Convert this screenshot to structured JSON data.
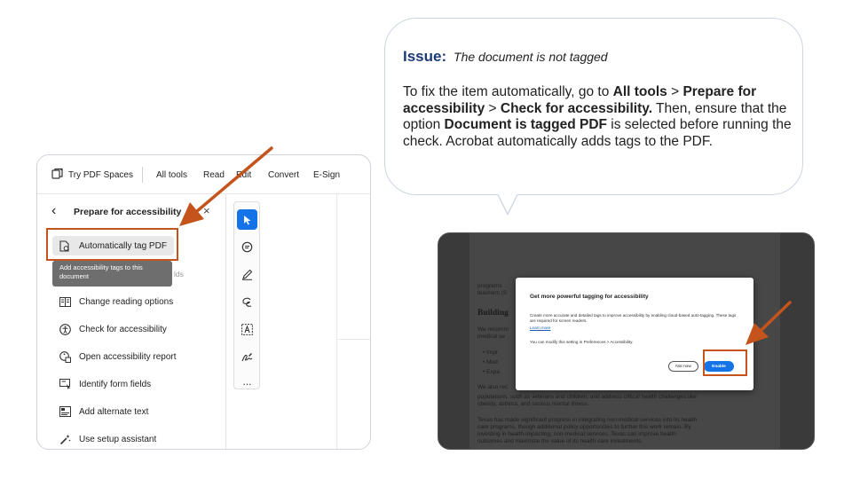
{
  "callout": {
    "issue_label": "Issue:",
    "issue_text": "The document is not tagged",
    "fix_parts": [
      {
        "text": "To fix the item automatically, go to ",
        "bold": false
      },
      {
        "text": "All tools",
        "bold": true
      },
      {
        "text": " > ",
        "bold": false
      },
      {
        "text": "Prepare for accessibility",
        "bold": true
      },
      {
        "text": " > ",
        "bold": false
      },
      {
        "text": "Check for accessibility.",
        "bold": true
      },
      {
        "text": " Then, ensure that the option ",
        "bold": false
      },
      {
        "text": "Document is tagged PDF",
        "bold": true
      },
      {
        "text": " is selected before running the check. Acrobat automatically adds tags to the PDF.",
        "bold": false
      }
    ]
  },
  "acrobat": {
    "topbar": {
      "spaces": "Try PDF Spaces",
      "all_tools": "All tools",
      "read": "Read",
      "edit": "Edit",
      "convert": "Convert",
      "esign": "E-Sign"
    },
    "sidebar_title": "Prepare for accessibility",
    "close_label": "×",
    "tooltip": "Add accessibility tags to this document",
    "tooltip_hidden_tail": "lds",
    "tools": [
      {
        "label": "Automatically tag PDF",
        "icon": "tag-pdf-icon"
      },
      {
        "label": "Change reading options",
        "icon": "reading-options-icon"
      },
      {
        "label": "Check for accessibility",
        "icon": "accessibility-check-icon"
      },
      {
        "label": "Open accessibility report",
        "icon": "accessibility-report-icon"
      },
      {
        "label": "Identify form fields",
        "icon": "form-fields-icon"
      },
      {
        "label": "Add alternate text",
        "icon": "alt-text-icon"
      },
      {
        "label": "Use setup assistant",
        "icon": "setup-assistant-icon"
      }
    ],
    "rail_icons": [
      "pointer-icon",
      "comment-icon",
      "highlight-pen-icon",
      "draw-icon",
      "text-select-icon",
      "sign-icon",
      "more-icon"
    ],
    "rail_more": "..."
  },
  "dialog": {
    "title": "Get more powerful tagging for accessibility",
    "body": "Create more accurate and detailed tags to improve accessibility by enabling cloud-based auto-tagging. These tags are required for screen readers.",
    "learn_more": "Learn more",
    "note": "You can modify this setting in Preferences > Accessibility.",
    "not_now": "Not now",
    "enable": "Enable"
  },
  "background_doc": {
    "heading": "Building",
    "lines_top": [
      "programs",
      "teachers (S"
    ],
    "lines_mid": [
      "We recomm",
      "medical se"
    ],
    "bullets": [
      "Impr",
      "Mod",
      "Expa"
    ],
    "lines_bottom": [
      "We also rec",
      "populations, such as veterans and children, and address critical health challenges like",
      "obesity, asthma, and serious mental illness.",
      "",
      "Texas has made significant progress in integrating non-medical services into its health",
      "care programs, though additional policy opportunities to further this work remain. By",
      "investing in health-impacting, non-medical services, Texas can improve health",
      "outcomes and maximize the value of its health care investments."
    ]
  },
  "colors": {
    "accent_orange": "#c4541c",
    "issue_blue": "#1b3a78",
    "acrobat_blue": "#1473e6"
  }
}
